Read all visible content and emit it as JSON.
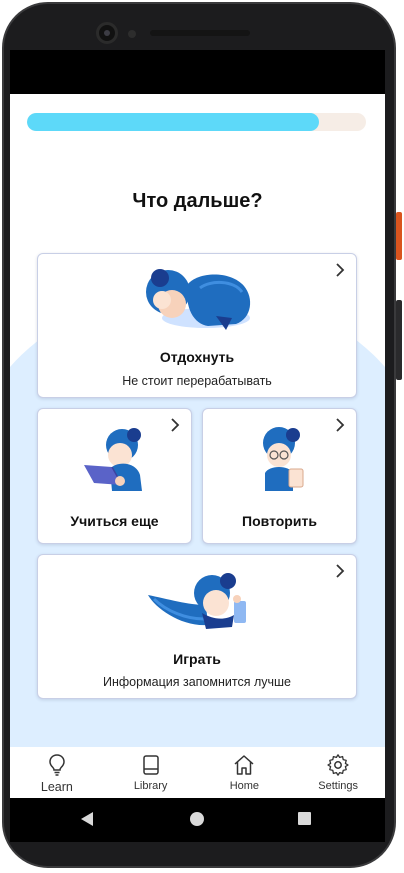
{
  "progress": {
    "value": 0.86
  },
  "page": {
    "title": "Что дальше?"
  },
  "cards": {
    "rest": {
      "title": "Отдохнуть",
      "subtitle": "Не стоит перерабатывать"
    },
    "study": {
      "title": "Учиться еще"
    },
    "review": {
      "title": "Повторить"
    },
    "play": {
      "title": "Играть",
      "subtitle": "Информация запомнится лучше"
    }
  },
  "nav": {
    "items": [
      {
        "label": "Learn",
        "icon": "lightbulb-icon"
      },
      {
        "label": "Library",
        "icon": "book-icon"
      },
      {
        "label": "Home",
        "icon": "home-icon"
      },
      {
        "label": "Settings",
        "icon": "gear-icon"
      }
    ]
  },
  "colors": {
    "accent": "#5dd9f9",
    "progress_track": "#f6ede6",
    "background_blob": "#ddeeff",
    "illustration_blue": "#1f6dbf",
    "illustration_dark": "#1a3d8f"
  }
}
